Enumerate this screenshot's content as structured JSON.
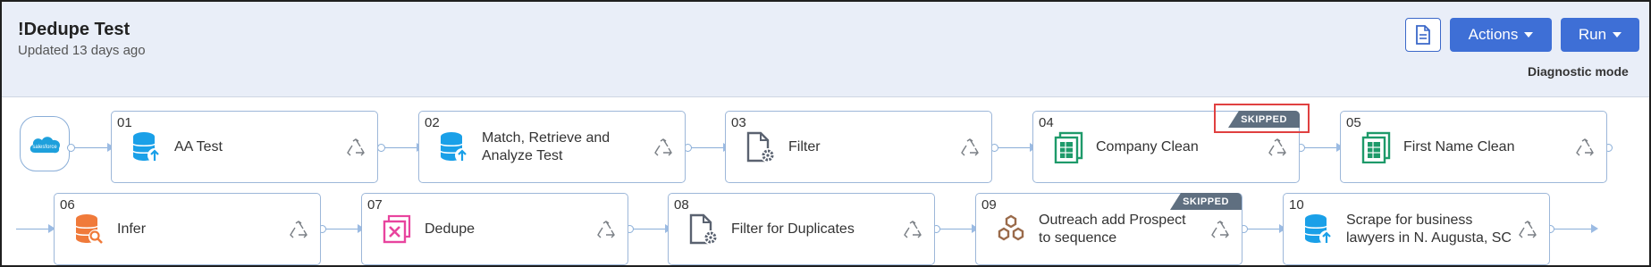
{
  "header": {
    "title": "!Dedupe Test",
    "subtitle": "Updated 13 days ago",
    "actions_label": "Actions",
    "run_label": "Run",
    "diagnostic_label": "Diagnostic mode"
  },
  "source": {
    "label": "salesforce"
  },
  "steps": [
    {
      "num": "01",
      "label": "AA Test",
      "icon": "database-upload-icon"
    },
    {
      "num": "02",
      "label": "Match, Retrieve and Analyze Test",
      "icon": "database-upload-icon"
    },
    {
      "num": "03",
      "label": "Filter",
      "icon": "file-gear-icon"
    },
    {
      "num": "04",
      "label": "Company Clean",
      "icon": "spreadsheet-icon",
      "badge": "SKIPPED"
    },
    {
      "num": "05",
      "label": "First Name Clean",
      "icon": "spreadsheet-icon"
    },
    {
      "num": "06",
      "label": "Infer",
      "icon": "database-search-icon"
    },
    {
      "num": "07",
      "label": "Dedupe",
      "icon": "dedupe-icon"
    },
    {
      "num": "08",
      "label": "Filter for Duplicates",
      "icon": "file-gear-icon"
    },
    {
      "num": "09",
      "label": "Outreach add Prospect to sequence",
      "icon": "hexagons-icon",
      "badge": "SKIPPED"
    },
    {
      "num": "10",
      "label": "Scrape for business lawyers in N. Augusta, SC",
      "icon": "database-upload-icon"
    }
  ],
  "colors": {
    "primary": "#3e6fd6",
    "header_bg": "#e9eef8",
    "skipped_badge": "#5f6f80",
    "highlight": "#e04040"
  }
}
